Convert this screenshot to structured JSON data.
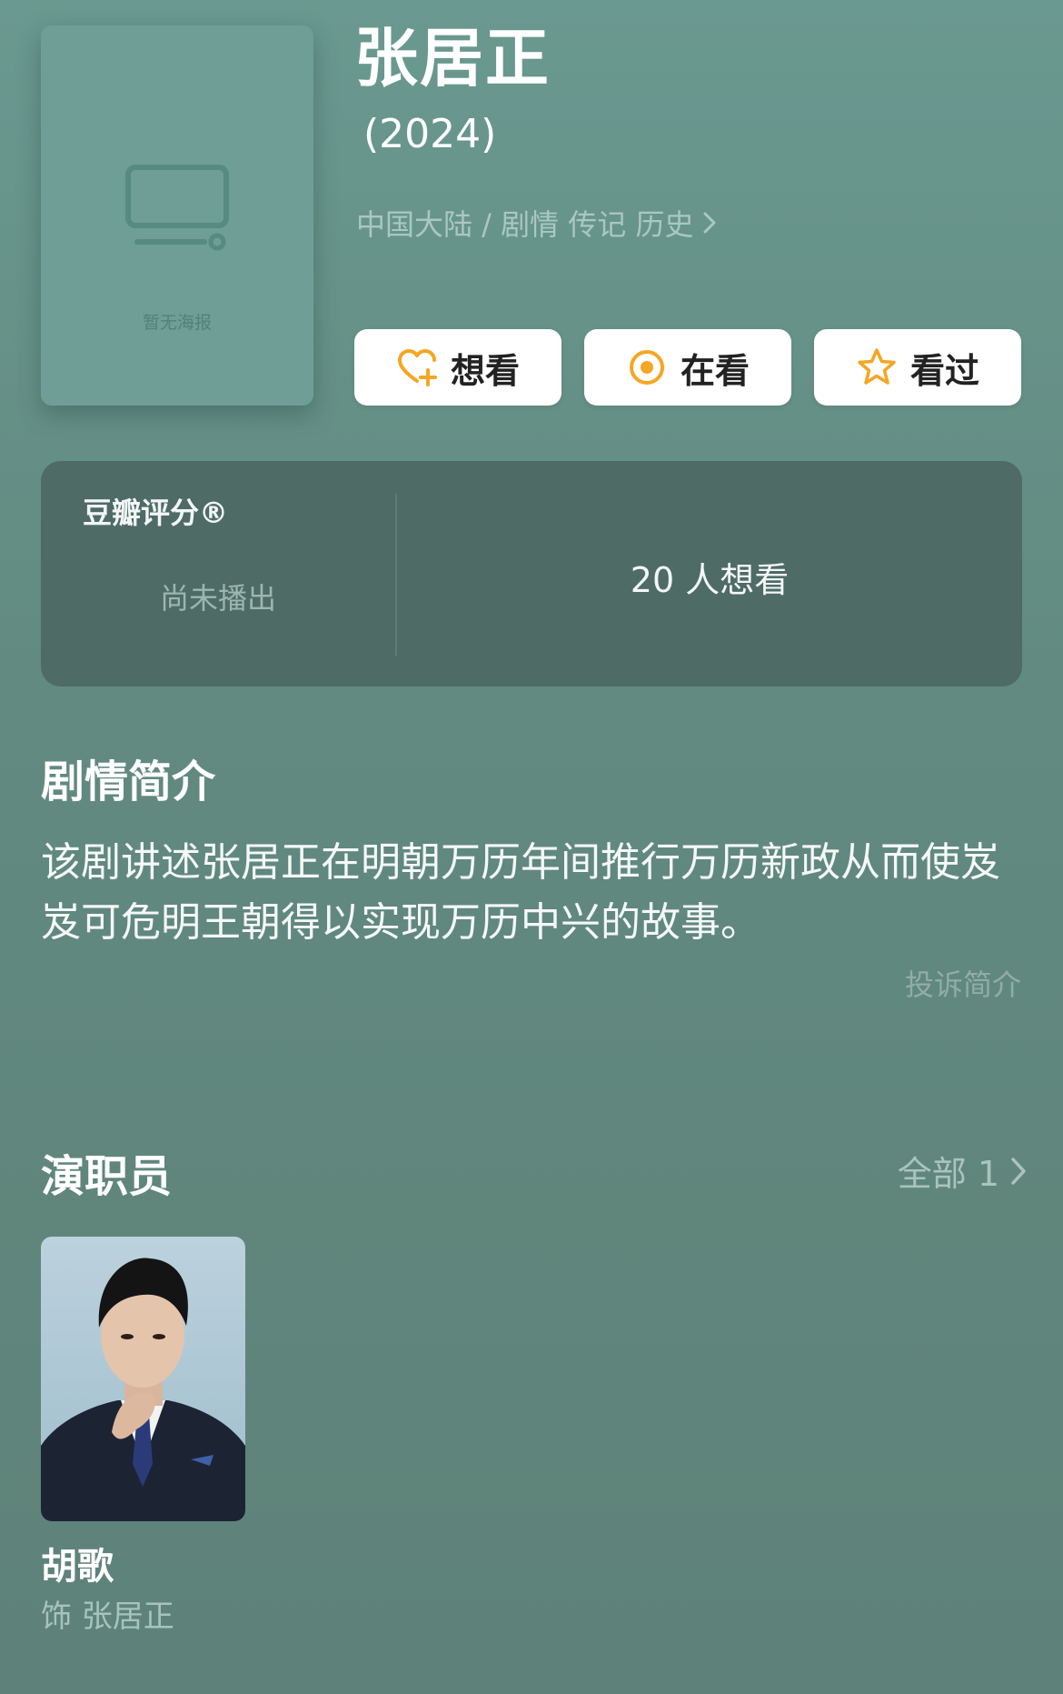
{
  "poster": {
    "placeholder_text": "暂无海报"
  },
  "header": {
    "title": "张居正",
    "year": "(2024)",
    "meta": "中国大陆 / 剧情 传记 历史"
  },
  "actions": {
    "want_label": "想看",
    "doing_label": "在看",
    "done_label": "看过",
    "accent_color": "#F5A623"
  },
  "rating": {
    "label": "豆瓣评分®",
    "status": "尚未播出",
    "want_count": "20 人想看"
  },
  "synopsis": {
    "title": "剧情简介",
    "text": "该剧讲述张居正在明朝万历年间推行万历新政从而使岌岌可危明王朝得以实现万历中兴的故事。",
    "report_label": "投诉简介"
  },
  "cast": {
    "title": "演职员",
    "all_label": "全部 1",
    "members": [
      {
        "name": "胡歌",
        "role": "饰 张居正"
      }
    ]
  }
}
